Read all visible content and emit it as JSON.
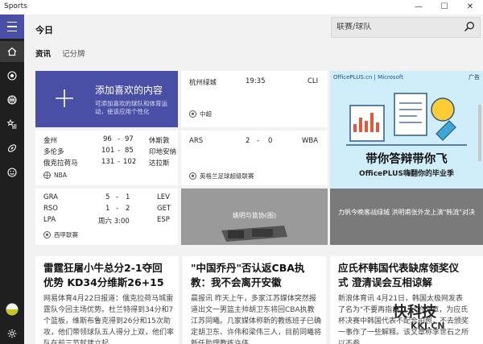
{
  "app": {
    "title": "Sports"
  },
  "window": {
    "minimize": "—",
    "maximize": "☐",
    "close": "✕"
  },
  "header": {
    "title": "今日",
    "search_placeholder": "联赛/球队",
    "tabs": [
      {
        "label": "资讯"
      },
      {
        "label": "记分牌"
      }
    ]
  },
  "rail": {
    "items": [
      "menu",
      "home",
      "soccer",
      "basketball",
      "favorites",
      "football",
      "smile",
      "settings"
    ]
  },
  "add_favorites": {
    "title": "添加喜欢的内容",
    "subtitle": "可添加喜欢的球队和体育运动，使该应用个性化"
  },
  "nba": {
    "rows": [
      {
        "home": "金州",
        "home_score": "96",
        "sep": "-",
        "away_score": "97",
        "away": "休斯敦"
      },
      {
        "home": "多伦多",
        "home_score": "101",
        "sep": "-",
        "away_score": "85",
        "away": "印地安纳"
      },
      {
        "home": "俄克拉荷马",
        "home_score": "131",
        "sep": "-",
        "away_score": "102",
        "away": "达拉斯"
      }
    ],
    "league": "NBA"
  },
  "csl": {
    "row": {
      "home": "杭州绿城",
      "time": "19:35",
      "away": "CLI"
    },
    "league": "中超"
  },
  "epl": {
    "row": {
      "home": "ARS",
      "home_score": "2",
      "sep": "-",
      "away_score": "0",
      "away": "WBA"
    },
    "league": "英格兰足球超级联赛"
  },
  "laliga": {
    "rows": [
      {
        "home": "GRA",
        "home_score": "5",
        "sep": "-",
        "away_score": "1",
        "away": "LEV"
      },
      {
        "home": "RSO",
        "home_score": "1",
        "sep": "-",
        "away_score": "2",
        "away": "GET"
      },
      {
        "home": "LPA",
        "home_score": "周六 3:00",
        "sep": "",
        "away_score": "",
        "away": "ESP"
      }
    ],
    "league": "西甲联赛"
  },
  "photo1": {
    "caption": "姚明与篮协(图)"
  },
  "photo2": {
    "caption": "力帆今晚客战绿城 洪明甫张外龙上演\"韩流\"对决"
  },
  "ad": {
    "brand": "OfficePLUS.cn | Microsoft",
    "label": "广告",
    "headline": "带你答辩带你飞",
    "sub": "OfficePLUS嗨翻你的毕业季"
  },
  "articles": [
    {
      "title": "雷霆狂屠小牛总分2-1夺回优势 KD34分维斯26+15",
      "body": "网易体育4月22日报道：俄克拉荷马城雷霆队今回主场优势。杜兰特得到34分和7个篮板，维斯布鲁克得到26分和15次助攻，他们带领球队五人得分上双，他们率队在前三节就建立起"
    },
    {
      "title": "\"中国乔丹\"否认返CBA执教：我不会离开安徽",
      "body": "晨报讯 昨天上午，多家江苏媒体突然报道出文一男篮主帅胡卫东将回CBA执教江苏同曦。几家媒体称新的教练班子已确定胡卫东、许伟和梁伟三人，目前同曦将新任助理教练许伟"
    },
    {
      "title": "应氏杯韩国代表缺席领奖仪式 澄清误会互相谅解",
      "body": "新浪体育讯 4月21日，韩国太极网发表了名为\"不要再指责……\"的文章，为应氏杯决赛中韩国代表不配合拍照，不去颁奖一事作了一些解释。该文章称李世石之所以不参"
    }
  ],
  "watermark": {
    "text": "快科技",
    "sub": "KKJ.CN"
  },
  "colors": {
    "accent": "#4a4fa6",
    "rail": "#1f1f1f",
    "tile_bg": "#ffffff",
    "photo_gray": "#8a8a8a"
  }
}
